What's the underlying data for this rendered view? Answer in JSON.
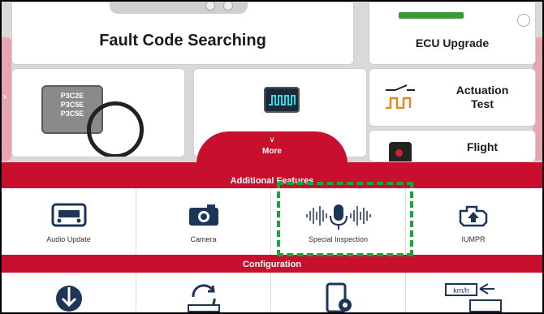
{
  "tiles": {
    "fault_code": "Fault Code Searching",
    "ecu_upgrade": "ECU Upgrade",
    "actuation_test": "Actuation\nTest",
    "flight": "Flight",
    "pcb_text": "P3C2E\nP3C5E\nP3C5E"
  },
  "sheet": {
    "more_label": "More",
    "additional_title": "Additional Features",
    "configuration_title": "Configuration"
  },
  "features": [
    {
      "label": "Audio Update",
      "icon": "audio-update-icon"
    },
    {
      "label": "Camera",
      "icon": "camera-icon"
    },
    {
      "label": "Special Inspection",
      "icon": "microphone-waveform-icon"
    },
    {
      "label": "IUMPR",
      "icon": "engine-check-icon"
    }
  ],
  "configuration": [
    {
      "icon": "download-globe-icon"
    },
    {
      "icon": "sync-refresh-icon"
    },
    {
      "icon": "tablet-settings-icon"
    },
    {
      "icon": "speed-unit-icon",
      "text": "km/h"
    }
  ],
  "colors": {
    "accent": "#c8102e",
    "highlight": "#1ea33a"
  }
}
